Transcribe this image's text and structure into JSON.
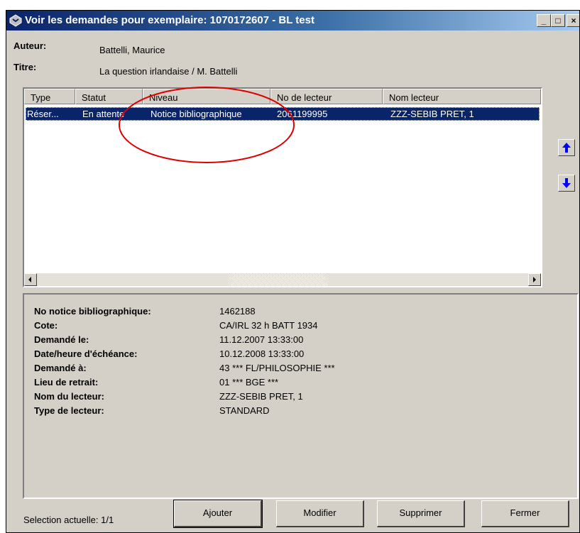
{
  "window": {
    "title": "Voir les demandes pour exemplaire: 1070172607 - BL test",
    "controls": {
      "minimize": "_",
      "maximize": "□",
      "close": "×"
    }
  },
  "header": {
    "author_label": "Auteur:",
    "author_value": "Battelli, Maurice",
    "title_label": "Titre:",
    "title_value": "La question irlandaise / M. Battelli"
  },
  "table": {
    "columns": [
      "Type",
      "Statut",
      "Niveau",
      "No de lecteur",
      "Nom lecteur"
    ],
    "rows": [
      {
        "type": "Réser...",
        "statut": "En attente",
        "niveau": "Notice bibliographique",
        "no_lecteur": "2061199995",
        "nom_lecteur": "ZZZ-SEBIB PRET, 1"
      }
    ]
  },
  "side_buttons": {
    "up_icon": "arrow-up-icon",
    "down_icon": "arrow-down-icon",
    "color": "#0000ff"
  },
  "details": [
    {
      "label": "No notice bibliographique:",
      "value": "1462188"
    },
    {
      "label": "Cote:",
      "value": "CA/IRL 32 h BATT 1934"
    },
    {
      "label": "Demandé le:",
      "value": "11.12.2007 13:33:00"
    },
    {
      "label": "Date/heure d'échéance:",
      "value": "10.12.2008 13:33:00"
    },
    {
      "label": "Demandé à:",
      "value": "43 *** FL/PHILOSOPHIE ***"
    },
    {
      "label": "Lieu de retrait:",
      "value": "01 *** BGE ***"
    },
    {
      "label": "Nom du lecteur:",
      "value": "ZZZ-SEBIB PRET, 1"
    },
    {
      "label": "Type de lecteur:",
      "value": "STANDARD"
    }
  ],
  "footer": {
    "selection": "Selection actuelle: 1/1",
    "buttons": {
      "add": "Ajouter",
      "modify": "Modifier",
      "delete": "Supprimer",
      "close": "Fermer"
    }
  },
  "colors": {
    "selection": "#0a246a",
    "face": "#d4d0c8",
    "annotation": "#e00000"
  }
}
